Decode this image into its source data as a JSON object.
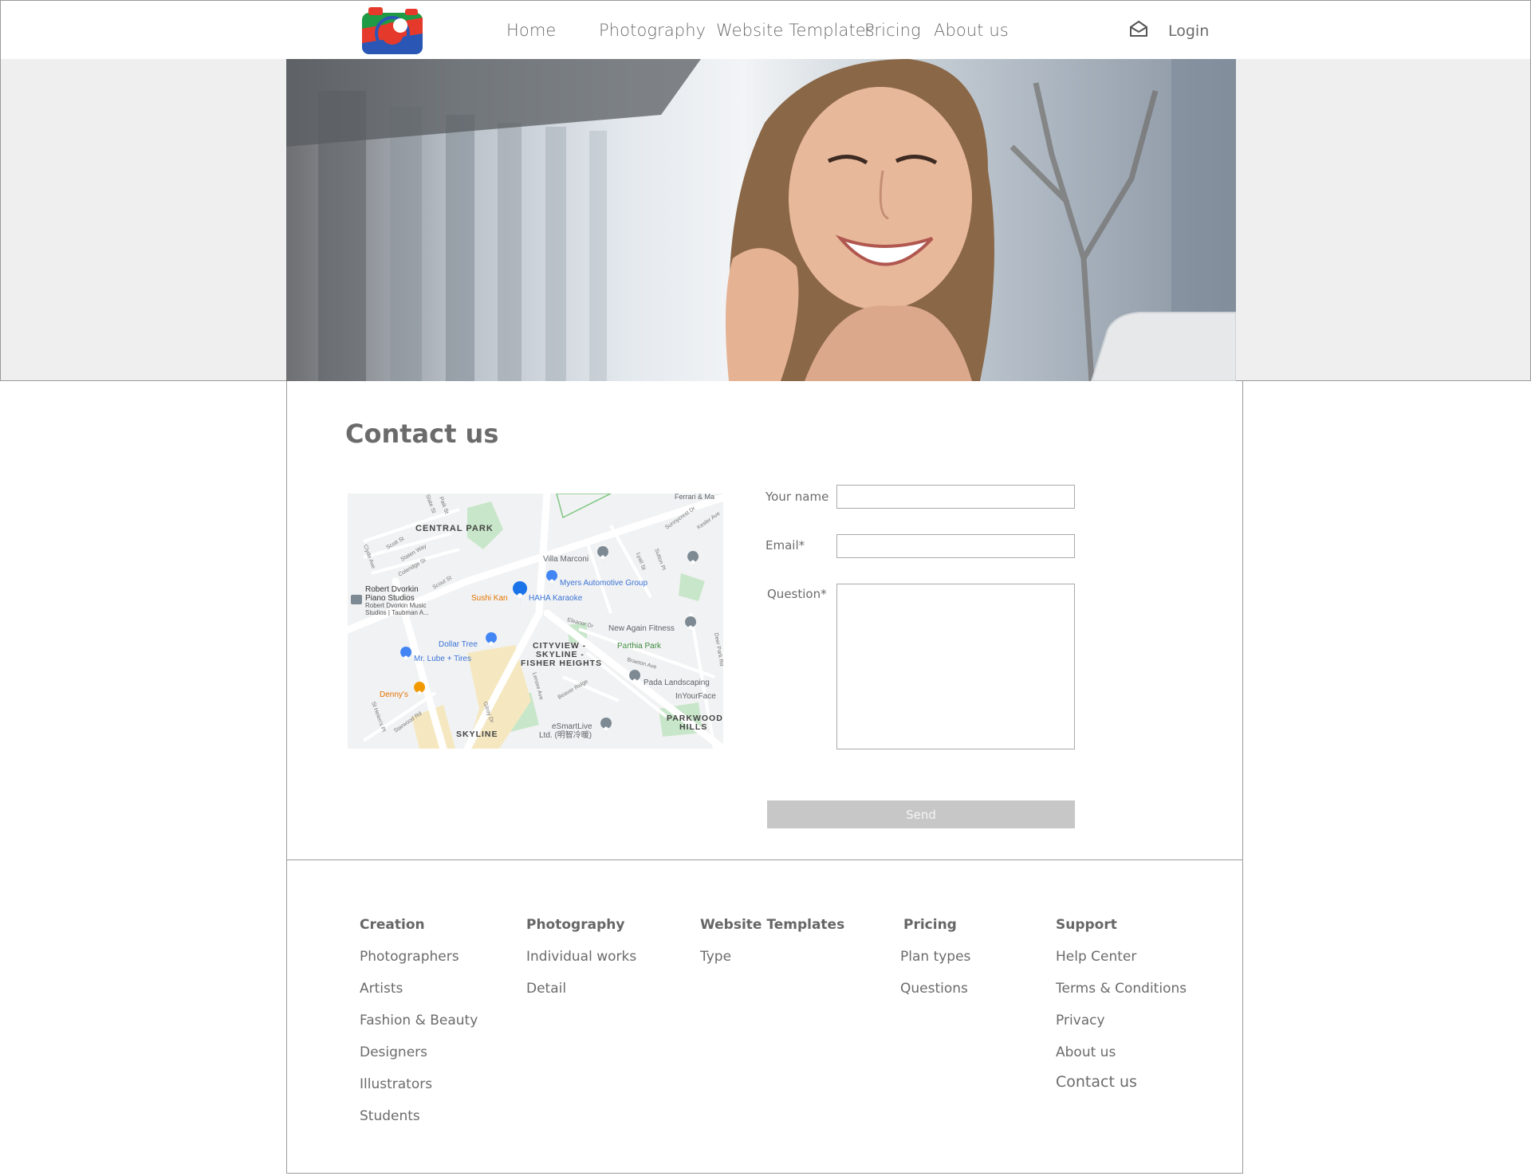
{
  "header": {
    "logo_icon": "camera-logo-icon",
    "nav": [
      "Home",
      "Photography",
      "Website Templates",
      "Pricing",
      "About us"
    ],
    "mail_icon": "envelope-open-icon",
    "login_label": "Login"
  },
  "hero": {
    "image_icon": "hero-photo",
    "background_color": "#efefef"
  },
  "contact": {
    "title": "Contact us",
    "name_label": "Your name",
    "name_value": "",
    "email_label": "Email*",
    "email_value": "",
    "question_label": "Question*",
    "question_value": "",
    "send_label": "Send",
    "send_color": "#c7c7c7"
  },
  "map": {
    "areas": [
      "CENTRAL PARK",
      "CITYVIEW -",
      "SKYLINE -",
      "FISHER HEIGHTS",
      "SKYLINE",
      "PARKWOOD",
      "HILLS"
    ],
    "places": {
      "villa": "Villa Marconi",
      "myers": "Myers Automotive Group",
      "sushi": "Sushi Kan",
      "haha": "HAHA Karaoke",
      "robert1": "Robert Dvorkin",
      "robert2": "Piano Studios",
      "robert3": "Robert Dvorkin Music",
      "robert4": "Studios | Taubman A...",
      "newagain": "New Again Fitness",
      "parthia": "Parthia Park",
      "dollar": "Dollar Tree",
      "mrlube": "Mr. Lube + Tires",
      "dennys": "Denny's",
      "pada": "Pada Landscaping",
      "inyourface": "InYourFace",
      "esmart1": "eSmartLive",
      "esmart2": "Ltd. (明智冷暖)",
      "ferrari": "Ferrari & Ma"
    },
    "streets": [
      "Scott St",
      "Staten Way",
      "Coleridge St",
      "Clyde Ave",
      "Sunnycrest Dr",
      "Kesler Ave",
      "Lyall St",
      "Sutton Pl",
      "Eleanor Dr",
      "Braeton Ave",
      "Beaver Ridge",
      "Deer Park Rd",
      "Starwood Rd",
      "St Helen's Pl",
      "Gilroy Dr",
      "Lenore Ave",
      "Scout St",
      "Paik St",
      "Slate St"
    ]
  },
  "footer": {
    "columns": [
      {
        "heading": "Creation",
        "links": [
          "Photographers",
          "Artists",
          "Fashion & Beauty",
          "Designers",
          "Illustrators",
          "Students"
        ]
      },
      {
        "heading": "Photography",
        "links": [
          "Individual works",
          "Detail"
        ]
      },
      {
        "heading": "Website Templates",
        "links": [
          "Type"
        ]
      },
      {
        "heading": "Pricing",
        "links": [
          "Plan types",
          "Questions"
        ]
      },
      {
        "heading": "Support",
        "links": [
          "Help Center",
          "Terms & Conditions",
          "Privacy",
          "About us",
          "Contact us"
        ]
      }
    ]
  }
}
